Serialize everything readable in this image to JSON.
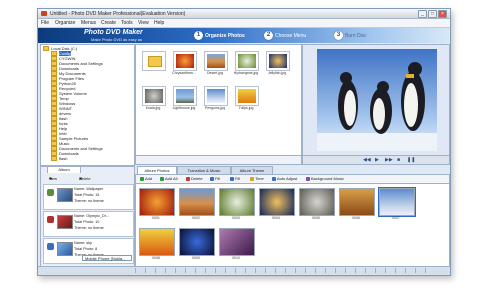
{
  "window": {
    "title": "Untitled - Photo DVD Maker Professional(Evaluation Version)",
    "controls": [
      "_",
      "□",
      "×"
    ]
  },
  "menu": [
    "File",
    "Organize",
    "Menus",
    "Create",
    "Tools",
    "View",
    "Help"
  ],
  "header": {
    "brand": "Photo DVD Maker",
    "tagline": "Make Photo DVD as easy as",
    "steps": [
      {
        "num": "1",
        "label": "Organize Photos"
      },
      {
        "num": "2",
        "label": "Choose Menu"
      },
      {
        "num": "3",
        "label": "Burn Disc"
      }
    ]
  },
  "tree": {
    "items": [
      "Local Disk (C:)",
      "Config",
      "CYGWIN",
      "Documents and Settings",
      "Downloads",
      "My Documents",
      "Program Files",
      "Python25",
      "Recycled",
      "System Volume",
      "Temp",
      "Windows",
      "WINNT",
      "drivers",
      "flash",
      "fonts",
      "Help",
      "Intel",
      "Sample Pictures",
      "Music",
      "Documents and Settings",
      "Downloads",
      "flash",
      "flash4",
      "Fortinet"
    ],
    "selected": "Config"
  },
  "thumbs": [
    {
      "name": "",
      "color": "#d8a030"
    },
    {
      "name": "Chrysanthem...",
      "color": "#d03a1a"
    },
    {
      "name": "Desert.jpg",
      "color": "#c0682a"
    },
    {
      "name": "Hydrangeas.jpg",
      "color": "#8a9a40"
    },
    {
      "name": "Jellyfish.jpg",
      "color": "#2d4a8a"
    },
    {
      "name": "Koala.jpg",
      "color": "#8a8a80"
    },
    {
      "name": "Lighthouse.jpg",
      "color": "#5d86c0"
    },
    {
      "name": "Penguins.jpg",
      "color": "#4f7fb8"
    },
    {
      "name": "Tulips.jpg",
      "color": "#e0a020"
    }
  ],
  "player_controls": [
    "◀◀",
    "▶",
    "▶▶",
    "■",
    "❚❚"
  ],
  "album_panel": {
    "tab": "Album",
    "new_label": "New",
    "delete_label": "Delete",
    "albums": [
      {
        "name": "Name: Wallpaper",
        "total": "Total Photo: 15",
        "theme": "Theme: no theme"
      },
      {
        "name": "Name: Olympic_Dr...",
        "total": "Total Photo: 10",
        "theme": "Theme: no theme"
      },
      {
        "name": "Name: sky",
        "total": "Total Photo: 8",
        "theme": "Theme: no theme"
      }
    ],
    "select_value": "Mobile Phone (Nokia..."
  },
  "tabs": [
    "Album Photos",
    "Transition & Music",
    "Album Theme"
  ],
  "toolbar": [
    {
      "label": "Add",
      "color": "#2f9a2f"
    },
    {
      "label": "Add All",
      "color": "#2f9a2f"
    },
    {
      "label": "Delete",
      "color": "#c8382a"
    },
    {
      "label": "Fill",
      "color": "#3a6cc0"
    },
    {
      "label": "Fill",
      "color": "#3a6cc0"
    },
    {
      "label": "Time",
      "color": "#e0a020"
    },
    {
      "label": "Auto Adjust",
      "color": "#3a6cc0"
    },
    {
      "label": "Background Music",
      "color": "#7a4ab0"
    }
  ],
  "strip": [
    {
      "cap": "0001",
      "color": "#d45a18"
    },
    {
      "cap": "0002",
      "color": "#b45a20"
    },
    {
      "cap": "0003",
      "color": "#6a9a3a"
    },
    {
      "cap": "0004",
      "color": "#2c4a8c"
    },
    {
      "cap": "0005",
      "color": "#8c8c84"
    },
    {
      "cap": "0006",
      "color": "#c27a2c"
    },
    {
      "cap": "0007",
      "color": "#4a78b0"
    },
    {
      "cap": "0008",
      "color": "#e8a020"
    },
    {
      "cap": "0009",
      "color": "#1a2a5a"
    },
    {
      "cap": "0010",
      "color": "#7a5a8a"
    }
  ]
}
